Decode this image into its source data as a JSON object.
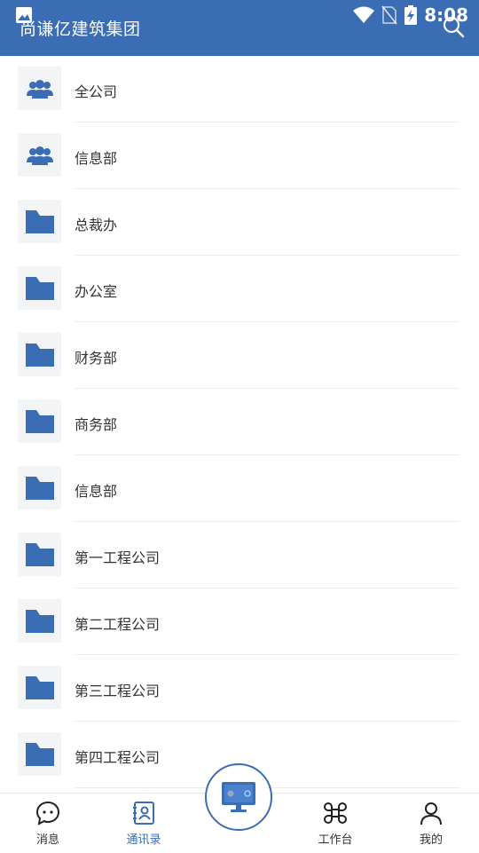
{
  "header": {
    "title": "尚谦亿建筑集团",
    "status_time": "8:08"
  },
  "list": {
    "items": [
      {
        "label": "全公司",
        "icon": "group-icon"
      },
      {
        "label": "信息部",
        "icon": "group-icon"
      },
      {
        "label": "总裁办",
        "icon": "folder-icon"
      },
      {
        "label": "办公室",
        "icon": "folder-icon"
      },
      {
        "label": "财务部",
        "icon": "folder-icon"
      },
      {
        "label": "商务部",
        "icon": "folder-icon"
      },
      {
        "label": "信息部",
        "icon": "folder-icon"
      },
      {
        "label": "第一工程公司",
        "icon": "folder-icon"
      },
      {
        "label": "第二工程公司",
        "icon": "folder-icon"
      },
      {
        "label": "第三工程公司",
        "icon": "folder-icon"
      },
      {
        "label": "第四工程公司",
        "icon": "folder-icon"
      }
    ]
  },
  "tabbar": {
    "messages": "消息",
    "contacts": "通讯录",
    "workbench": "工作台",
    "mine": "我的",
    "active": "contacts"
  },
  "colors": {
    "accent": "#3b6db5",
    "tile_bg": "#f3f4f6"
  }
}
